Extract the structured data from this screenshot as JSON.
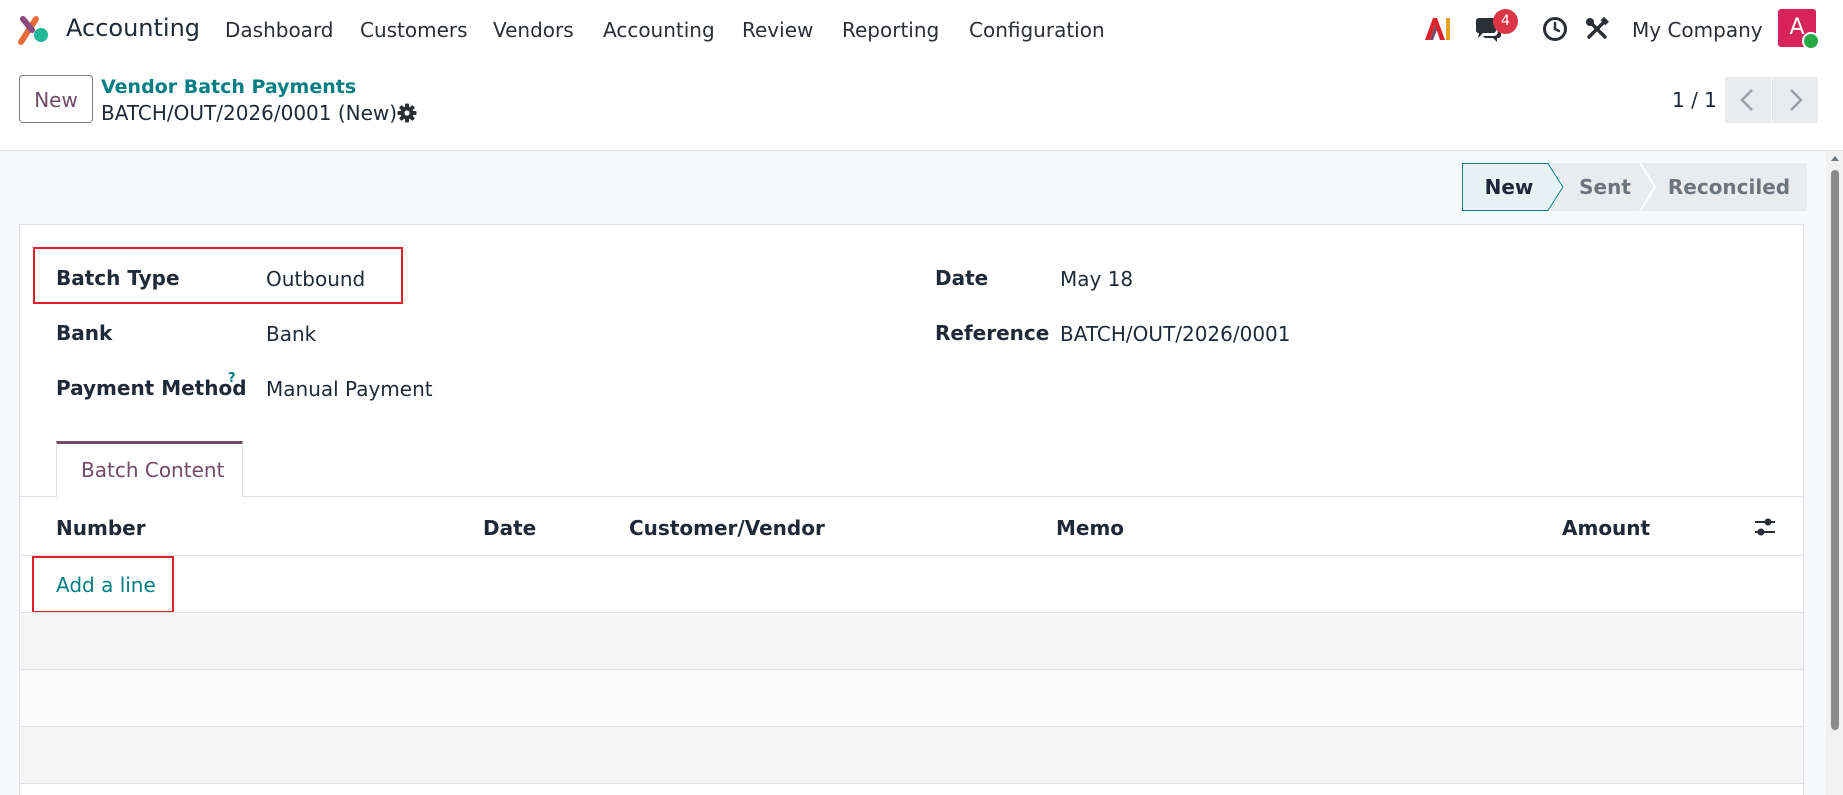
{
  "app": {
    "name": "Accounting"
  },
  "menu": [
    "Dashboard",
    "Customers",
    "Vendors",
    "Accounting",
    "Review",
    "Reporting",
    "Configuration"
  ],
  "systray": {
    "ai_label": "AI",
    "messages_count": "4",
    "company": "My Company",
    "avatar_letter": "A"
  },
  "control": {
    "new_label": "New",
    "breadcrumb": "Vendor Batch Payments",
    "record_title": "BATCH/OUT/2026/0001 (New)",
    "pager": "1 / 1"
  },
  "status": {
    "stages": [
      "New",
      "Sent",
      "Reconciled"
    ],
    "active": "New"
  },
  "form": {
    "batch_type_label": "Batch Type",
    "batch_type_value": "Outbound",
    "bank_label": "Bank",
    "bank_value": "Bank",
    "payment_method_label": "Payment Method",
    "payment_method_help": "?",
    "payment_method_value": "Manual Payment",
    "date_label": "Date",
    "date_value": "May 18",
    "reference_label": "Reference",
    "reference_value": "BATCH/OUT/2026/0001"
  },
  "tabs": {
    "batch_content": "Batch Content"
  },
  "table": {
    "columns": [
      "Number",
      "Date",
      "Customer/Vendor",
      "Memo",
      "Amount"
    ],
    "add_line": "Add a line"
  },
  "colors": {
    "brand": "#714b67",
    "link": "#017e84",
    "highlight": "#e0212b",
    "active_stage_bg": "#e6f2f3"
  }
}
